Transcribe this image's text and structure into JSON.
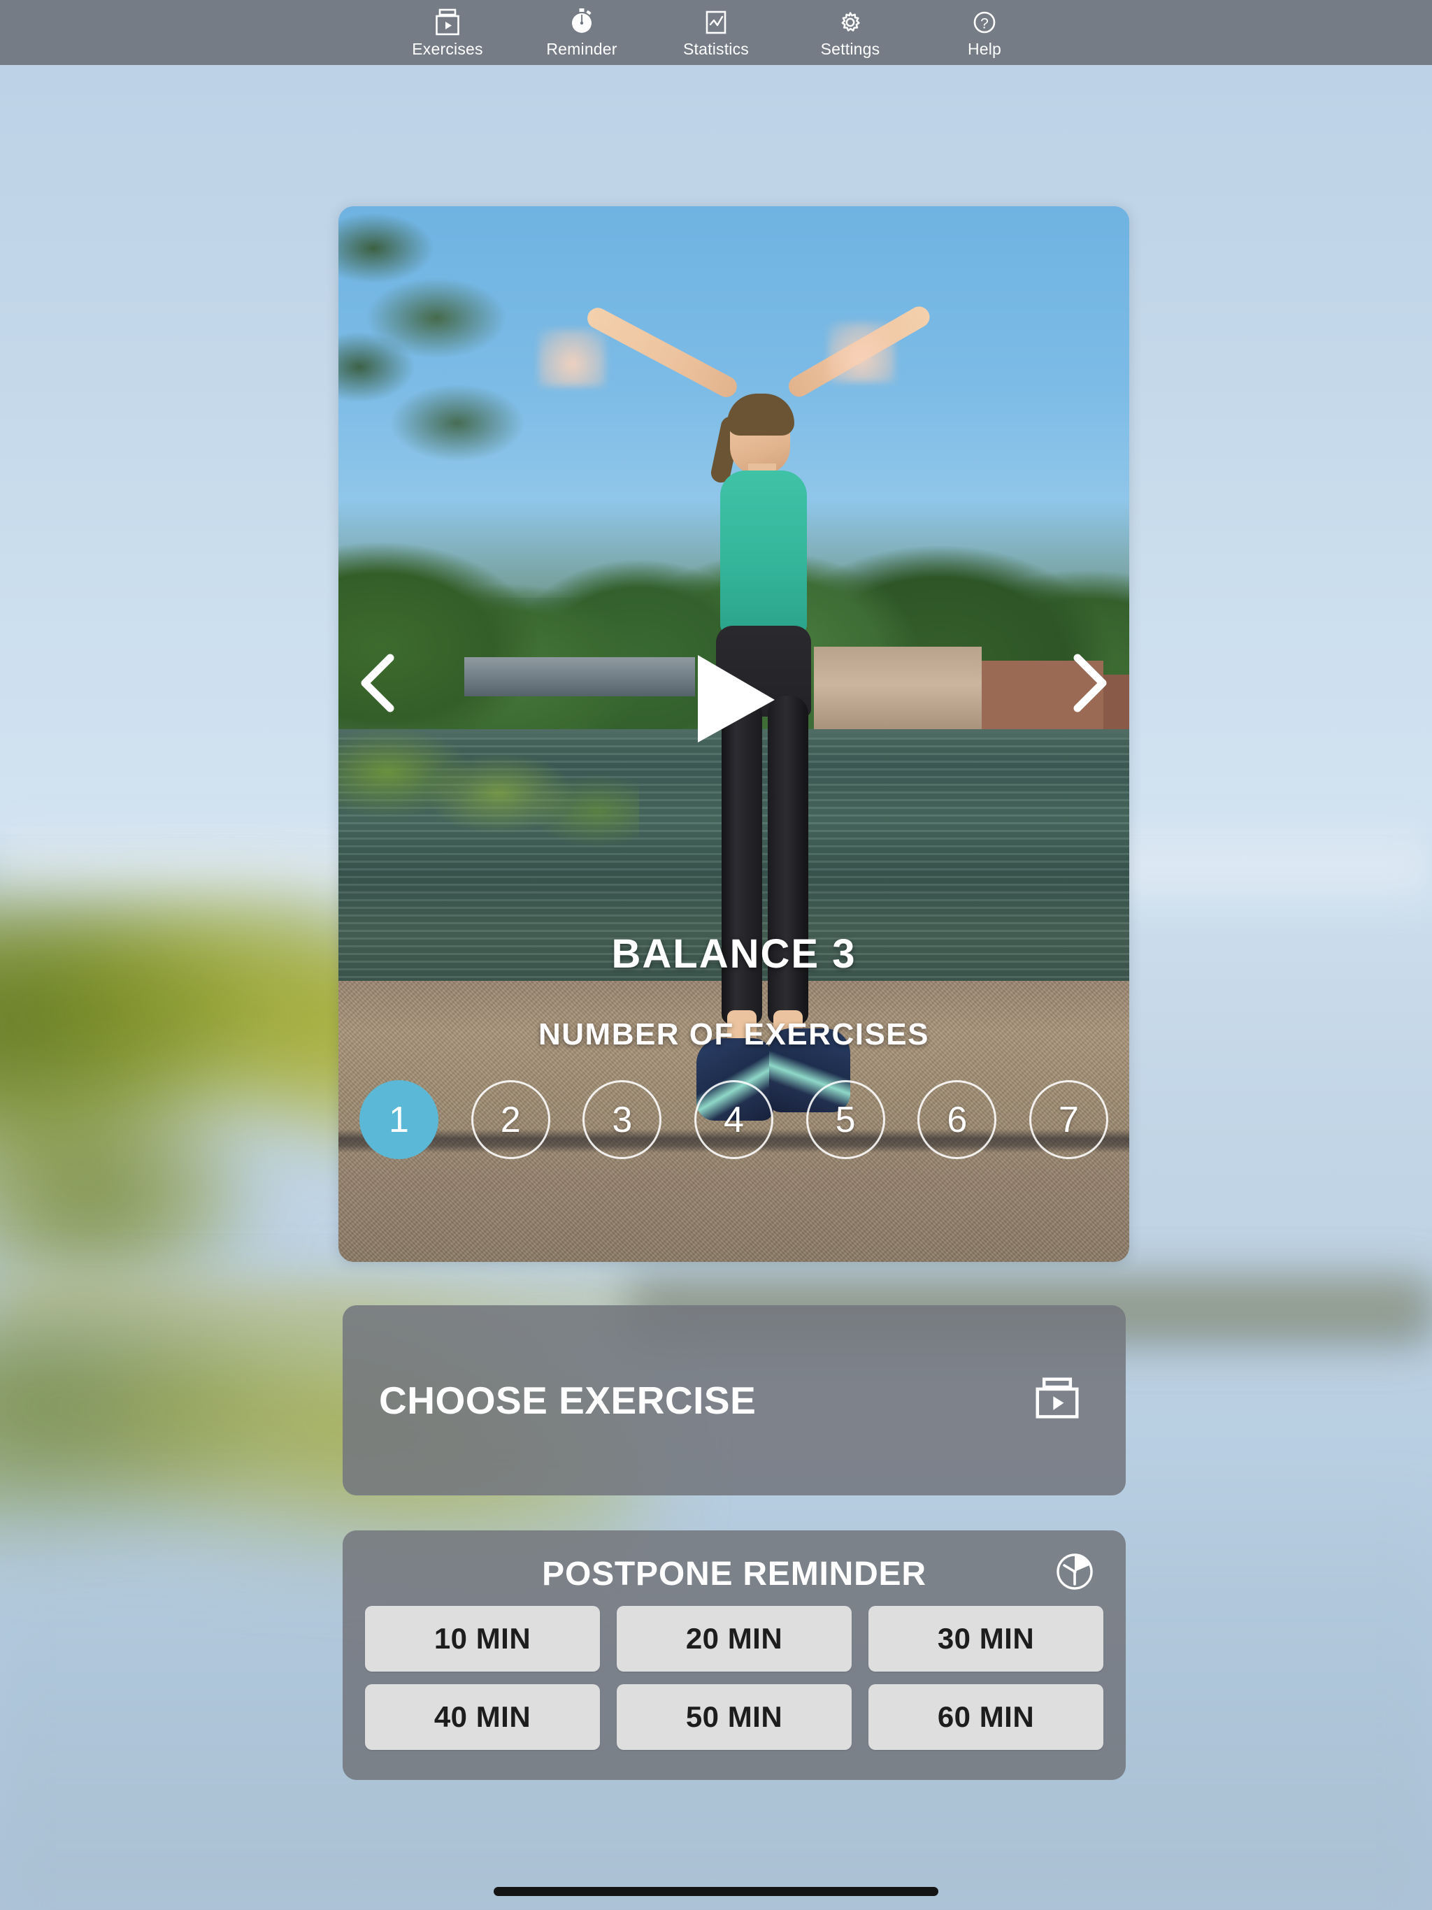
{
  "nav": {
    "items": [
      {
        "label": "Exercises",
        "icon": "video-icon"
      },
      {
        "label": "Reminder",
        "icon": "stopwatch-icon"
      },
      {
        "label": "Statistics",
        "icon": "chart-icon"
      },
      {
        "label": "Settings",
        "icon": "gear-icon"
      },
      {
        "label": "Help",
        "icon": "question-circle-icon"
      }
    ]
  },
  "video": {
    "title": "BALANCE 3",
    "prev_icon": "chevron-left-icon",
    "next_icon": "chevron-right-icon",
    "play_icon": "play-icon",
    "exercises_label": "NUMBER OF EXERCISES",
    "counts": [
      "1",
      "2",
      "3",
      "4",
      "5",
      "6",
      "7"
    ],
    "selected_count": "1",
    "selected_color": "#5bb8d6"
  },
  "choose_exercise": {
    "label": "CHOOSE EXERCISE",
    "icon": "video-icon"
  },
  "postpone": {
    "title": "POSTPONE REMINDER",
    "icon": "clock-icon",
    "options": [
      "10 MIN",
      "20 MIN",
      "30 MIN",
      "40 MIN",
      "50 MIN",
      "60 MIN"
    ]
  },
  "colors": {
    "navbar": "#757c85",
    "panel": "#74787e",
    "accent": "#5bb8d6",
    "button": "#dedede"
  }
}
